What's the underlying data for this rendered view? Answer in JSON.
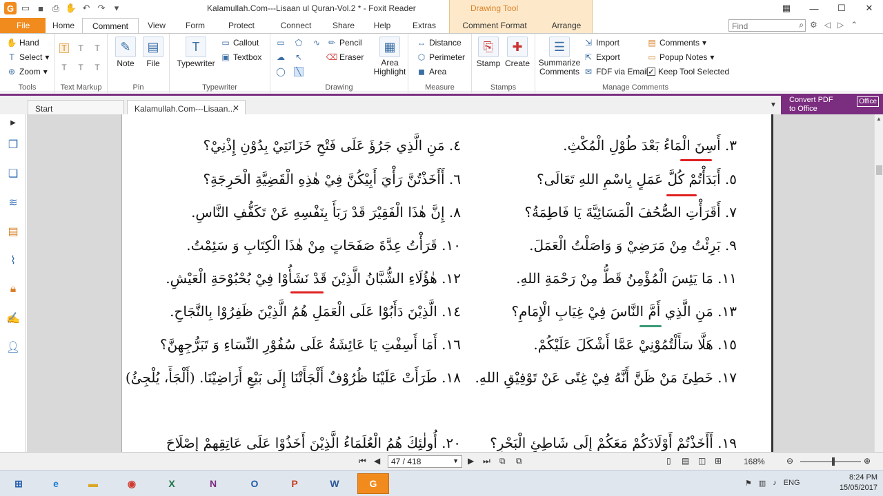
{
  "window": {
    "title": "Kalamullah.Com---Lisaan ul Quran-Vol.2 * - Foxit Reader",
    "context_tab": "Drawing Tool"
  },
  "menu": {
    "file": "File",
    "tabs": [
      "Home",
      "Comment",
      "View",
      "Form",
      "Protect",
      "Connect",
      "Share",
      "Help",
      "Extras",
      "Comment Format",
      "Arrange"
    ],
    "active_tab": "Comment",
    "search_placeholder": "Find"
  },
  "ribbon": {
    "tools": {
      "label": "Tools",
      "hand": "Hand",
      "select": "Select",
      "zoom": "Zoom"
    },
    "text_markup": {
      "label": "Text Markup"
    },
    "pin": {
      "label": "Pin",
      "note": "Note",
      "file": "File"
    },
    "typewriter": {
      "label": "Typewriter",
      "typewriter": "Typewriter",
      "callout": "Callout",
      "textbox": "Textbox"
    },
    "drawing": {
      "label": "Drawing",
      "pencil": "Pencil",
      "eraser": "Eraser",
      "area_highlight": "Area Highlight"
    },
    "measure": {
      "label": "Measure",
      "distance": "Distance",
      "perimeter": "Perimeter",
      "area": "Area"
    },
    "stamps": {
      "label": "Stamps",
      "stamp": "Stamp",
      "create": "Create"
    },
    "manage": {
      "label": "Manage Comments",
      "summarize": "Summarize Comments",
      "import": "Import",
      "export": "Export",
      "fdf_email": "FDF via Email",
      "comments": "Comments",
      "popup_notes": "Popup Notes",
      "keep_tool": "Keep Tool Selected"
    }
  },
  "doc_tabs": {
    "start": "Start",
    "document": "Kalamullah.Com---Lisaan...",
    "convert_line1": "Convert PDF",
    "convert_line2": "to Office",
    "convert_badge": "Office"
  },
  "page_lines": [
    {
      "text": "٣. أَسِنَ الْمَاءُ بَعْدَ طُوْلِ الْمُكْثِ."
    },
    {
      "text": "٤. مَنِ الَّذِي جَرُؤَ عَلَى فَتْحِ خَزَانَتِيْ بِدُوْنِ إِذْنِيْ؟"
    },
    {
      "text": "٥. أَبَدَأْتُمْ كُلَّ عَمَلٍ بِاسْمِ اللهِ تَعَالَى؟"
    },
    {
      "text": "٦. أَأَخَذْتُنَّ رَأْيَ أَبِيْكُنَّ فِيْ هٰذِهِ الْقَضِيَّةِ الْحَرِجَةِ؟"
    },
    {
      "text": "٧. أَقَرَأْتِ الصُّحُفَ الْمَسَائِيَّةَ يَا فَاطِمَةُ؟"
    },
    {
      "text": "٨. إِنَّ هٰذَا الْفَقِيْرَ قَدْ رَبَأَ بِنَفْسِهِ عَنْ تَكَفُّفِ النَّاسِ."
    },
    {
      "text": "٩. بَرِئْتُ مِنْ مَرَضِيْ وَ وَاصَلْتُ الْعَمَلَ."
    },
    {
      "text": "١٠. قَرَأْتُ عِدَّةَ صَفَحَاتٍ مِنْ هٰذَا الْكِتَابِ وَ سَئِمْتُ."
    },
    {
      "text": "١١. مَا يَئِسَ الْمُؤْمِنُ قَطُّ مِنْ رَحْمَةِ اللهِ."
    },
    {
      "text": "١٢. هٰؤُلَاءِ الشُّبَّانُ الَّذِيْنَ قَدْ نَشَأُوْا فِيْ بُحْبُوْحَةِ الْعَيْشِ."
    },
    {
      "text": "١٣. مَنِ الَّذِي أَمَّ النَّاسَ فِيْ غِيَابِ الْإِمَامِ؟"
    },
    {
      "text": "١٤. الَّذِيْنَ دَأَبُوْا عَلَى الْعَمَلِ هُمُ الَّذِيْنَ ظَفِرُوْا بِالنَّجَاحِ."
    },
    {
      "text": "١٥. هَلَّا سَأَلْتُمُوْنِيْ عَمَّا أَشْكَلَ عَلَيْكُمْ."
    },
    {
      "text": "١٦. أَمَا أَسِفْتِ يَا عَائِشَةُ عَلَى سُفُوْرِ النِّسَاءِ وَ تَبَرُّجِهِنَّ؟"
    },
    {
      "text": "١٧. خَطِئَ مَنْ ظَنَّ أَنَّهُ فِيْ غِنًى عَنْ تَوْفِيْقِ اللهِ."
    },
    {
      "text": "١٨. طَرَأَتْ عَلَيْنَا ظُرُوْفٌ أَلْجَأَتْنَا إِلَى بَيْعِ أَرَاضِيْنَا. (أَلْجَأَ، يُلْجِئُ)"
    },
    {
      "text": "١٩. أَأَخَذْتُمْ أَوْلَادَكُمْ مَعَكُمْ إِلَى شَاطِئِ الْبَحْرِ؟"
    },
    {
      "text": "٢٠. أُولٰئِكَ هُمُ الْعُلَمَاءُ الَّذِيْنَ أَخَذُوْا عَلَى عَاتِقِهِمْ إِصْلَاحَ"
    }
  ],
  "status": {
    "page": "47 / 418",
    "zoom": "168%",
    "zoom_slider_fraction": 0.55
  },
  "tray": {
    "lang": "ENG",
    "time": "8:24 PM",
    "date": "15/05/2017"
  },
  "colors": {
    "accent": "#f28b1e",
    "context": "#fde9c9",
    "convert_bg": "#7b2d7f",
    "markup_red": "#e02020"
  }
}
